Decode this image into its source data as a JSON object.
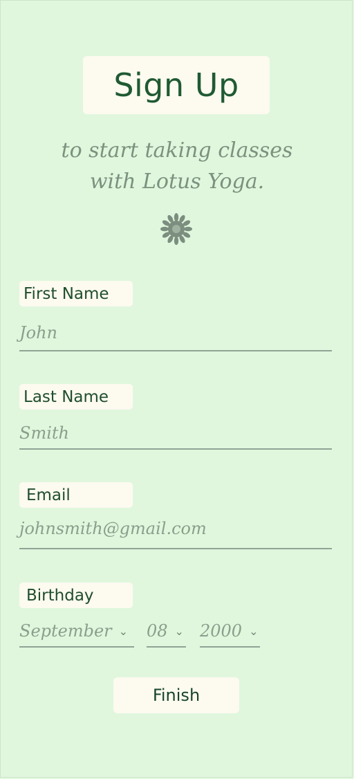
{
  "header": {
    "title": "Sign Up",
    "subtitle_line1": "to start taking classes",
    "subtitle_line2": "with Lotus Yoga.",
    "logo_icon": "lotus-icon"
  },
  "form": {
    "first_name": {
      "label": "First Name",
      "value": "John"
    },
    "last_name": {
      "label": "Last Name",
      "value": "Smith"
    },
    "email": {
      "label": "Email",
      "value": "johnsmith@gmail.com"
    },
    "birthday": {
      "label": "Birthday",
      "month": "September",
      "day": "08",
      "year": "2000"
    }
  },
  "actions": {
    "finish_label": "Finish"
  },
  "colors": {
    "background": "#e0f7dd",
    "card": "#fdfaf0",
    "heading": "#1f5a32",
    "muted_text": "#8a9f8c"
  }
}
